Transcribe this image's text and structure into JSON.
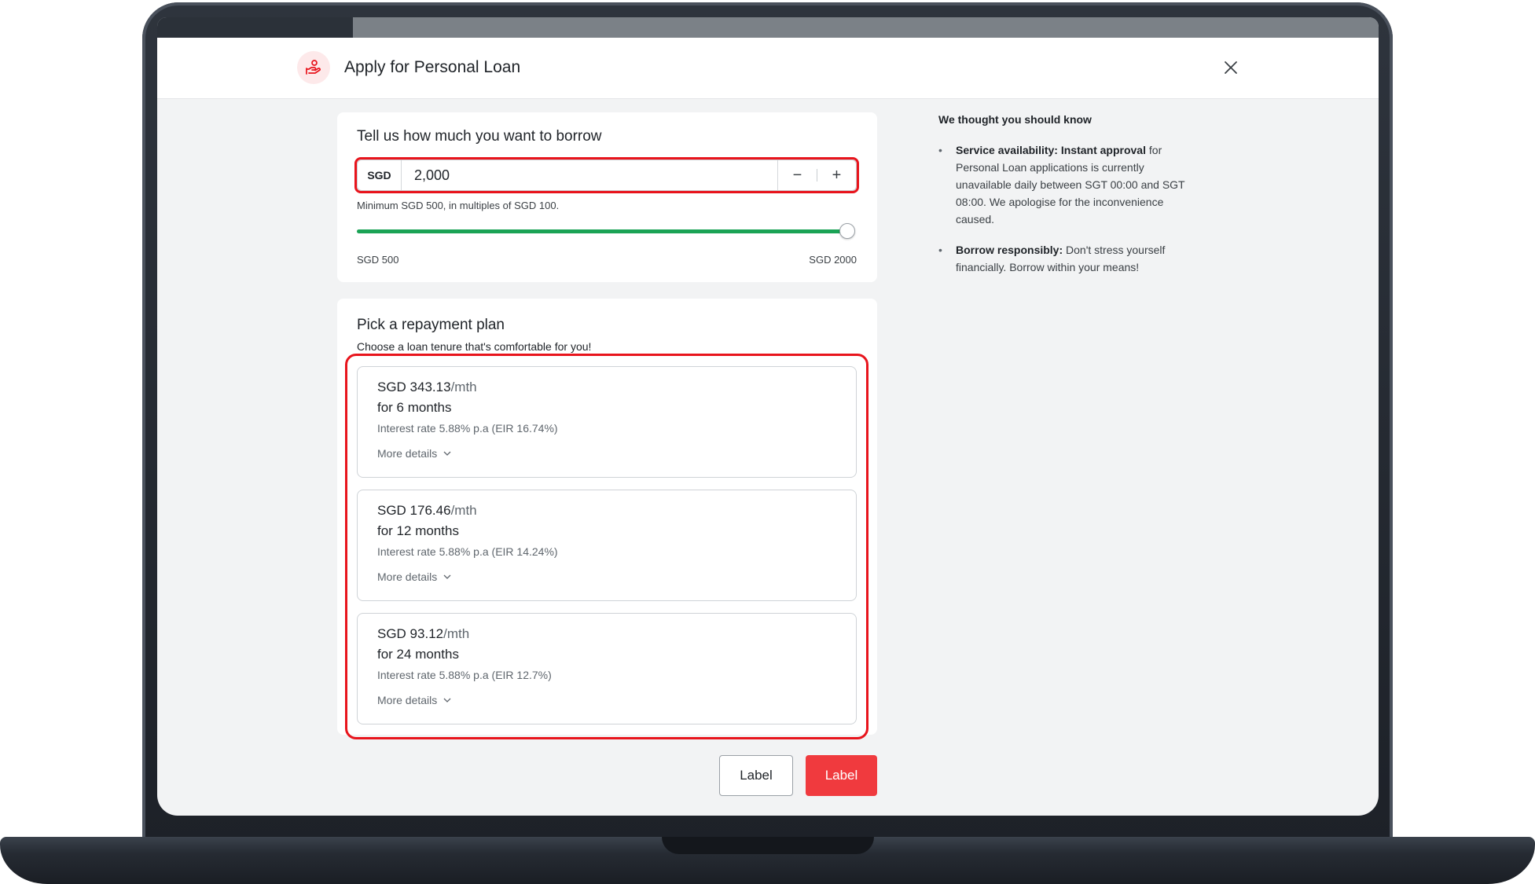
{
  "header": {
    "title": "Apply for Personal Loan",
    "progress_percent": 16
  },
  "borrow": {
    "title": "Tell us how much you want to borrow",
    "currency": "SGD",
    "amount": "2,000",
    "minus_label": "−",
    "plus_label": "+",
    "helper": "Minimum SGD 500, in multiples of SGD 100.",
    "slider": {
      "min_label": "SGD 500",
      "max_label": "SGD 2000",
      "min": 500,
      "max": 2000,
      "value": 2000
    }
  },
  "plans": {
    "title": "Pick a repayment plan",
    "subtitle": "Choose a loan tenure that's comfortable for you!",
    "items": [
      {
        "price": "SGD 343.13",
        "unit": "/mth",
        "tenure": "for 6 months",
        "rate": "Interest rate 5.88% p.a (EIR 16.74%)",
        "more": "More details"
      },
      {
        "price": "SGD 176.46",
        "unit": "/mth",
        "tenure": "for 12 months",
        "rate": "Interest rate 5.88% p.a (EIR 14.24%)",
        "more": "More details"
      },
      {
        "price": "SGD 93.12",
        "unit": "/mth",
        "tenure": "for 24 months",
        "rate": "Interest rate 5.88% p.a (EIR 12.7%)",
        "more": "More details"
      }
    ]
  },
  "footer": {
    "secondary_label": "Label",
    "primary_label": "Label"
  },
  "info": {
    "title": "We thought you should know",
    "items": [
      {
        "bold": "Service availability: Instant approval",
        "text": " for Personal Loan applications is currently unavailable daily between SGT 00:00 and SGT 08:00. We apologise for the inconvenience caused."
      },
      {
        "bold": "Borrow responsibly:",
        "text": " Don't stress yourself financially. Borrow within your means!"
      }
    ]
  },
  "colors": {
    "accent_red": "#f03a3e",
    "highlight_red": "#e8141c",
    "slider_green": "#1aa355"
  },
  "icons": {
    "logo": "hand-holding-money-icon",
    "close": "close-icon",
    "more": "chevron-down-icon"
  }
}
